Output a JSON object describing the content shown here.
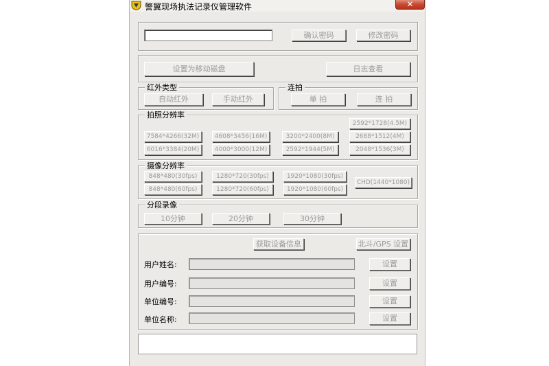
{
  "window": {
    "title": "警翼现场执法记录仪管理软件",
    "close_label": "✕"
  },
  "password": {
    "value": "",
    "confirm_label": "确认密码",
    "change_label": "修改密码"
  },
  "storage": {
    "mobile_disk_label": "设置为移动磁盘",
    "log_label": "日志查看"
  },
  "infrared": {
    "legend": "红外类型",
    "auto_label": "自动红外",
    "manual_label": "手动红外"
  },
  "burst": {
    "legend": "连拍",
    "single_label": "单 拍",
    "continuous_label": "连 拍"
  },
  "photo_res": {
    "legend": "拍照分辨率",
    "options": [
      "2592*1728(4.5M)",
      "7584*4266(32M)",
      "4608*3456(16M)",
      "3200*2400(8M)",
      "2688*1512(4M)",
      "6016*3384(20M)",
      "4000*3000(12M)",
      "2592*1944(5M)",
      "2048*1536(3M)"
    ]
  },
  "video_res": {
    "legend": "摄像分辨率",
    "options": [
      "848*480(30fps)",
      "1280*720(30fps)",
      "1920*1080(30fps)",
      "848*480(60fps)",
      "1280*720(60fps)",
      "1920*1080(60fps)",
      "CHD(1440*1080)"
    ]
  },
  "segment": {
    "legend": "分段录像",
    "options": [
      "10分钟",
      "20分钟",
      "30分钟"
    ]
  },
  "device": {
    "get_info_label": "获取设备信息",
    "gps_label": "北斗/GPS 设置",
    "rows": [
      {
        "label": "用户姓名:",
        "value": "",
        "button": "设置"
      },
      {
        "label": "用户编号:",
        "value": "",
        "button": "设置"
      },
      {
        "label": "单位编号:",
        "value": "",
        "button": "设置"
      },
      {
        "label": "单位名称:",
        "value": "",
        "button": "设置"
      }
    ]
  }
}
